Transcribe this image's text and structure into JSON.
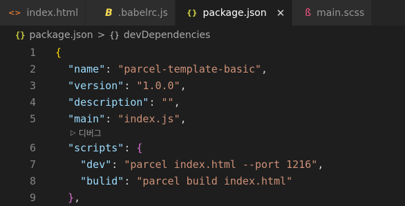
{
  "tabs": [
    {
      "label": "index.html",
      "icon": "html-icon",
      "glyph": "<>",
      "color": "#e37933"
    },
    {
      "label": ".babelrc.js",
      "icon": "babel-icon",
      "glyph": "B",
      "color": "#f5da55"
    },
    {
      "label": "package.json",
      "icon": "json-icon",
      "glyph": "{}",
      "color": "#cbcb41",
      "active": true,
      "close": "✕"
    },
    {
      "label": "main.scss",
      "icon": "sass-icon",
      "glyph": "ß",
      "color": "#f55385"
    }
  ],
  "breadcrumb": {
    "file": "package.json",
    "separator": ">",
    "node": "devDependencies"
  },
  "codelens": {
    "label": "디버그"
  },
  "lines": [
    {
      "n": "1",
      "indent": 0,
      "tokens": [
        {
          "t": "{",
          "c": "b"
        }
      ]
    },
    {
      "n": "2",
      "indent": 1,
      "tokens": [
        {
          "t": "\"name\"",
          "c": "k"
        },
        {
          "t": ": ",
          "c": "p"
        },
        {
          "t": "\"parcel-template-basic\"",
          "c": "s"
        },
        {
          "t": ",",
          "c": "p"
        }
      ]
    },
    {
      "n": "3",
      "indent": 1,
      "tokens": [
        {
          "t": "\"version\"",
          "c": "k"
        },
        {
          "t": ": ",
          "c": "p"
        },
        {
          "t": "\"1.0.0\"",
          "c": "s"
        },
        {
          "t": ",",
          "c": "p"
        }
      ]
    },
    {
      "n": "4",
      "indent": 1,
      "tokens": [
        {
          "t": "\"description\"",
          "c": "k"
        },
        {
          "t": ": ",
          "c": "p"
        },
        {
          "t": "\"\"",
          "c": "s"
        },
        {
          "t": ",",
          "c": "p"
        }
      ]
    },
    {
      "n": "5",
      "indent": 1,
      "tokens": [
        {
          "t": "\"main\"",
          "c": "k"
        },
        {
          "t": ": ",
          "c": "p"
        },
        {
          "t": "\"index.js\"",
          "c": "s"
        },
        {
          "t": ",",
          "c": "p"
        }
      ]
    },
    {
      "lens": true
    },
    {
      "n": "6",
      "indent": 1,
      "tokens": [
        {
          "t": "\"scripts\"",
          "c": "k"
        },
        {
          "t": ": ",
          "c": "p"
        },
        {
          "t": "{",
          "c": "b2"
        }
      ]
    },
    {
      "n": "7",
      "indent": 2,
      "tokens": [
        {
          "t": "\"dev\"",
          "c": "k"
        },
        {
          "t": ": ",
          "c": "p"
        },
        {
          "t": "\"parcel index.html --port 1216\"",
          "c": "s"
        },
        {
          "t": ",",
          "c": "p"
        }
      ]
    },
    {
      "n": "8",
      "indent": 2,
      "tokens": [
        {
          "t": "\"bulid\"",
          "c": "k"
        },
        {
          "t": ": ",
          "c": "p"
        },
        {
          "t": "\"parcel build index.html\"",
          "c": "s"
        }
      ]
    },
    {
      "n": "9",
      "indent": 1,
      "tokens": [
        {
          "t": "}",
          "c": "b2"
        },
        {
          "t": ",",
          "c": "p"
        }
      ]
    }
  ]
}
